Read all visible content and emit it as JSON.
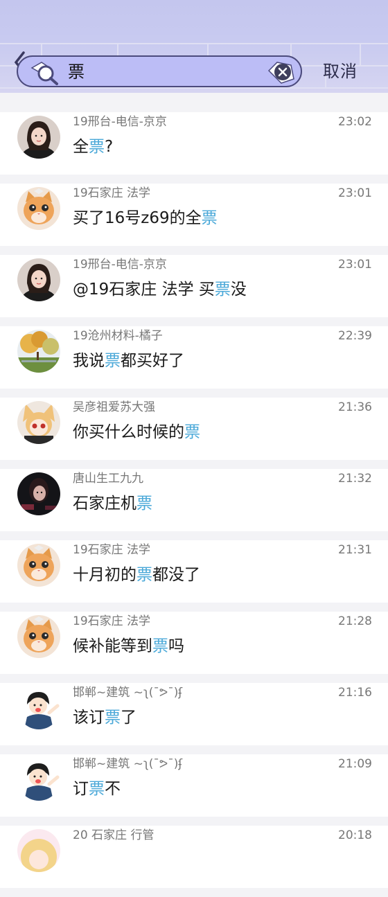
{
  "search": {
    "query": "票",
    "cancel_label": "取消"
  },
  "results": [
    {
      "name": "19邢台-电信-京京",
      "time": "23:02",
      "pre": "全",
      "kw": "票",
      "post": "?",
      "avatar": "girl"
    },
    {
      "name": "19石家庄 法学",
      "time": "23:01",
      "pre": "买了16号z69的全",
      "kw": "票",
      "post": "",
      "avatar": "cat"
    },
    {
      "name": "19邢台-电信-京京",
      "time": "23:01",
      "pre": "@19石家庄 法学 买",
      "kw": "票",
      "post": "没",
      "avatar": "girl"
    },
    {
      "name": "19沧州材料-橘子",
      "time": "22:39",
      "pre": "我说",
      "kw": "票",
      "post": "都买好了",
      "avatar": "autumn"
    },
    {
      "name": "吴彦祖爱苏大强",
      "time": "21:36",
      "pre": "你买什么时候的",
      "kw": "票",
      "post": "",
      "avatar": "anime"
    },
    {
      "name": "唐山生工九九",
      "time": "21:32",
      "pre": "石家庄机",
      "kw": "票",
      "post": "",
      "avatar": "dark"
    },
    {
      "name": "19石家庄 法学",
      "time": "21:31",
      "pre": "十月初的",
      "kw": "票",
      "post": "都没了",
      "avatar": "cat"
    },
    {
      "name": "19石家庄 法学",
      "time": "21:28",
      "pre": "候补能等到",
      "kw": "票",
      "post": "吗",
      "avatar": "cat"
    },
    {
      "name": "邯郸~建筑 ~ʅ(ˉᕗˉ)ʄ",
      "time": "21:16",
      "pre": "该订",
      "kw": "票",
      "post": "了",
      "avatar": "boy"
    },
    {
      "name": "邯郸~建筑 ~ʅ(ˉᕗˉ)ʄ",
      "time": "21:09",
      "pre": "订",
      "kw": "票",
      "post": "不",
      "avatar": "boy"
    },
    {
      "name": "20 石家庄 行管",
      "time": "20:18",
      "pre": "",
      "kw": "",
      "post": "",
      "avatar": "blonde"
    }
  ],
  "colors": {
    "highlight": "#4aa8d8",
    "header": "#c6c8ef"
  }
}
